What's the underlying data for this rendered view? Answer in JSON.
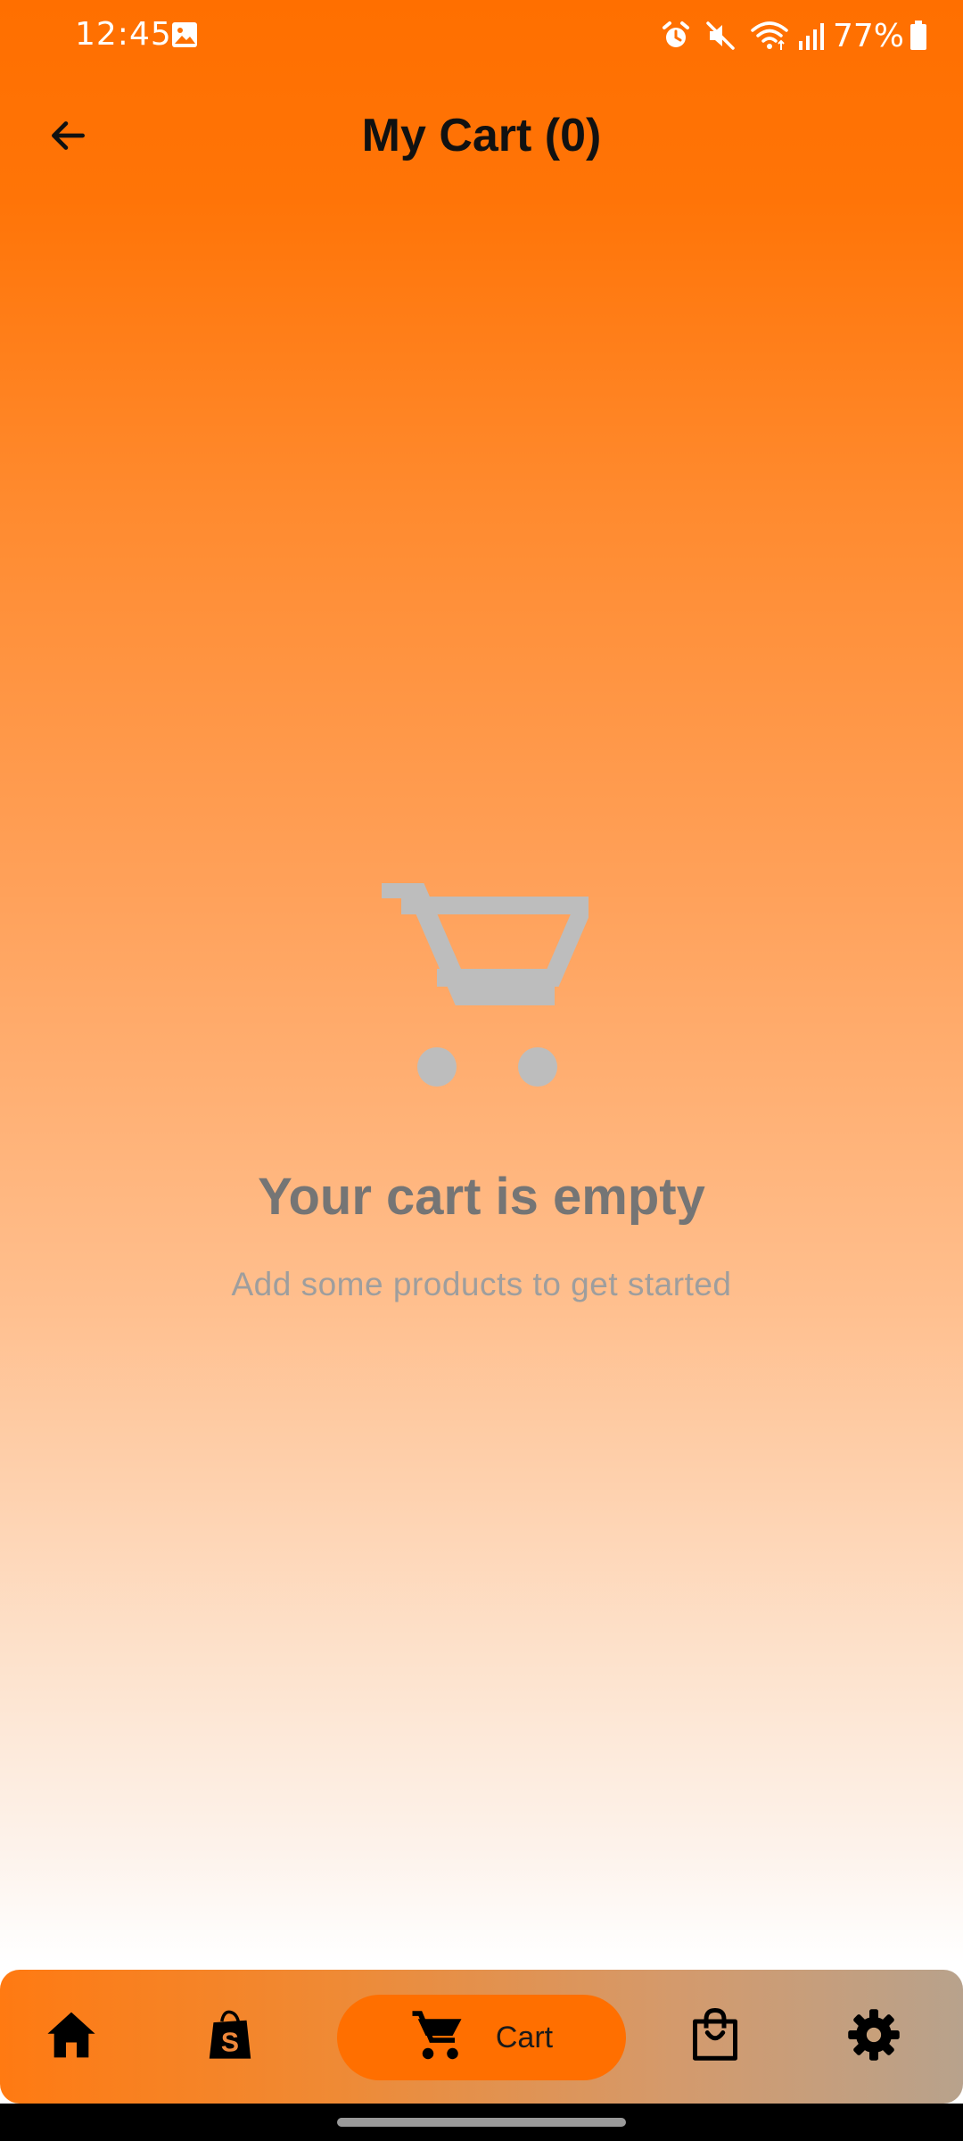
{
  "status_bar": {
    "time": "12:45",
    "battery_text": "77%",
    "icons": [
      "image-icon",
      "alarm-icon",
      "mute-icon",
      "wifi-icon",
      "signal-icon",
      "battery-icon"
    ]
  },
  "app_bar": {
    "title": "My Cart (0)",
    "back_icon": "arrow-back-icon"
  },
  "empty_state": {
    "icon": "shopping-cart-icon",
    "title": "Your cart is empty",
    "subtitle": "Add some products to get started"
  },
  "bottom_nav": {
    "items": [
      {
        "icon": "home-icon",
        "label": "",
        "selected": false
      },
      {
        "icon": "shopify-bag-icon",
        "label": "",
        "selected": false
      },
      {
        "icon": "cart-icon",
        "label": "Cart",
        "selected": true
      },
      {
        "icon": "shopping-bag-icon",
        "label": "",
        "selected": false
      },
      {
        "icon": "settings-icon",
        "label": "",
        "selected": false
      }
    ]
  },
  "colors": {
    "primary": "#ff6f00",
    "empty_icon": "#bdbdbd",
    "empty_title": "#757575",
    "empty_subtitle": "#9e9e9e"
  }
}
